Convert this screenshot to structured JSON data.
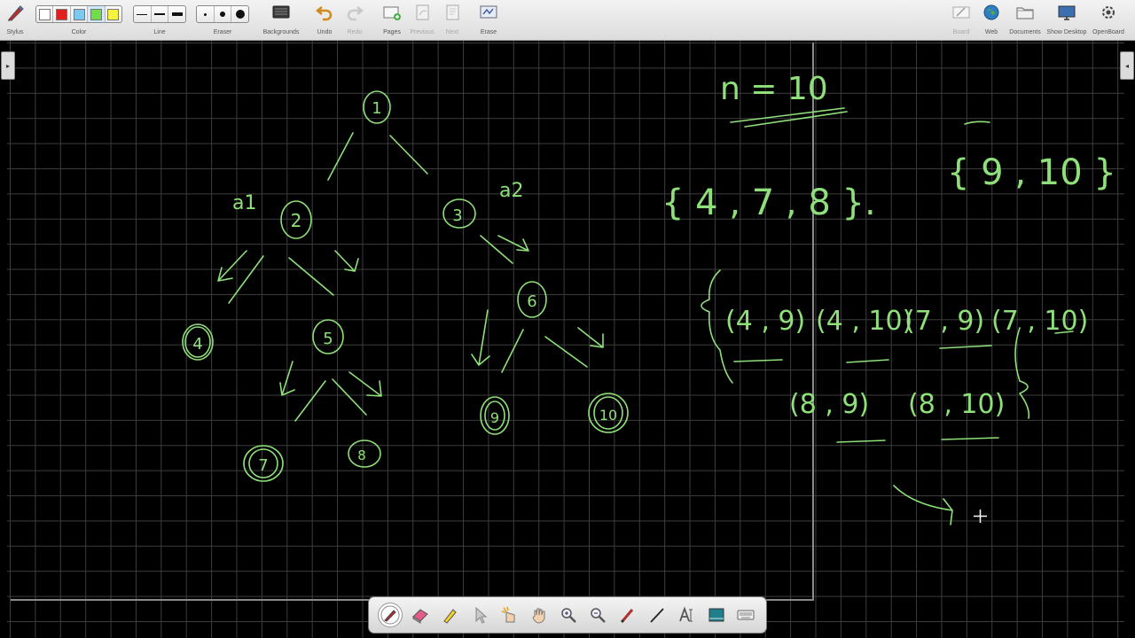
{
  "toolbar": {
    "stylus_label": "Stylus",
    "color_label": "Color",
    "line_label": "Line",
    "eraser_label": "Eraser",
    "backgrounds_label": "Backgrounds",
    "undo_label": "Undo",
    "redo_label": "Redo",
    "pages_label": "Pages",
    "previous_label": "Previous",
    "next_label": "Next",
    "erase_label": "Erase",
    "board_label": "Board",
    "web_label": "Web",
    "documents_label": "Documents",
    "show_desktop_label": "Show Desktop",
    "openboard_label": "OpenBoard",
    "colors": [
      "#ffffff",
      "#e02020",
      "#7ec8f0",
      "#6fdc4a",
      "#f5f240"
    ],
    "selected_color": "#6fdc4a"
  },
  "board": {
    "ink_color": "#8fe07a",
    "background": "#000000",
    "grid_color": "#3d3d3d",
    "tree_nodes": [
      "1",
      "2",
      "3",
      "4",
      "5",
      "6",
      "7",
      "8",
      "9",
      "10"
    ],
    "edge_labels": [
      "a1",
      "a2"
    ],
    "n_equation": "n = 10",
    "set_a": "{ 4 , 7 , 8 }.",
    "set_b": "{ 9 , 10 }",
    "pairs_row1": [
      "(4 , 9)",
      "(4 , 10)",
      "(7 , 9)",
      "(7 , 10)"
    ],
    "pairs_row2": [
      "(8 , 9)",
      "(8 , 10)"
    ]
  },
  "palette": {
    "tools": [
      "pen-icon",
      "eraser-icon",
      "marker-icon",
      "pointer-icon",
      "laser-icon",
      "hand-icon",
      "zoom-in-icon",
      "zoom-out-icon",
      "pointer-pen-icon",
      "line-icon",
      "text-icon",
      "capture-icon",
      "keyboard-icon"
    ],
    "active_tool": "pen-icon"
  }
}
